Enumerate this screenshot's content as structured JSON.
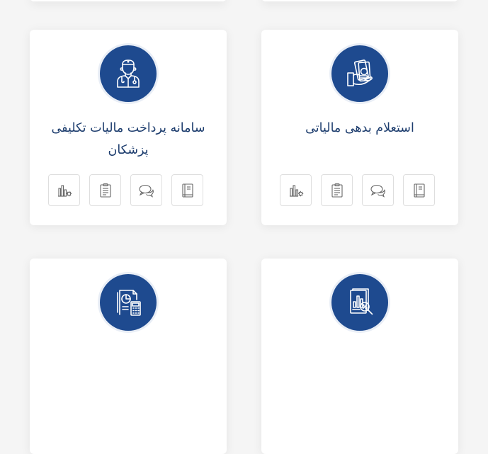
{
  "cards": [
    {
      "title": "استعلام بدهی مالیاتی",
      "avatar_icon": "money-hand-icon",
      "actions": [
        "book-icon",
        "chat-bubbles-icon",
        "clipboard-icon",
        "chart-gear-icon"
      ]
    },
    {
      "title": "سامانه پرداخت مالیات تکلیفی پزشکان",
      "avatar_icon": "doctor-icon",
      "actions": [
        "book-icon",
        "chat-bubbles-icon",
        "clipboard-icon",
        "chart-gear-icon"
      ]
    },
    {
      "title": "",
      "avatar_icon": "report-magnifier-icon"
    },
    {
      "title": "",
      "avatar_icon": "calculator-report-icon"
    }
  ],
  "colors": {
    "accent": "#1e4a8f",
    "title_text": "#1d3d6e",
    "background": "#f5f5f5",
    "card": "#ffffff",
    "action_border": "#dedede",
    "action_icon": "#666666"
  }
}
